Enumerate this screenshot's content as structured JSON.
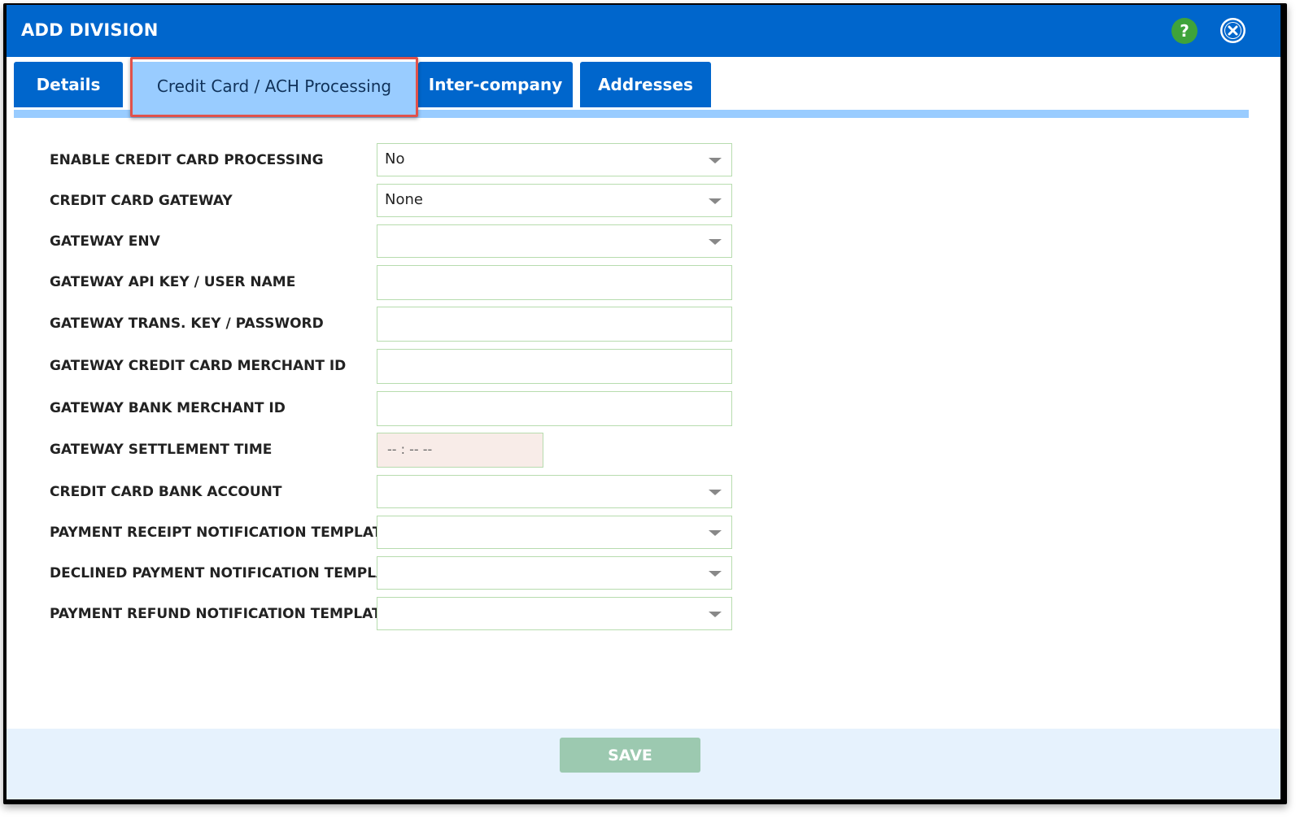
{
  "dialog": {
    "title": "ADD DIVISION",
    "help_icon": "question-mark-icon",
    "help_glyph": "?",
    "close_icon": "close-circle-icon"
  },
  "tabs": [
    {
      "label": "Details",
      "active": false
    },
    {
      "label": "Credit Card / ACH Processing",
      "active": true
    },
    {
      "label": "Inter-company",
      "active": false
    },
    {
      "label": "Addresses",
      "active": false
    }
  ],
  "form": {
    "fields": [
      {
        "label": "ENABLE CREDIT CARD PROCESSING",
        "type": "select",
        "value": "No"
      },
      {
        "label": "CREDIT CARD GATEWAY",
        "type": "select",
        "value": "None"
      },
      {
        "label": "GATEWAY ENV",
        "type": "select",
        "value": ""
      },
      {
        "label": "GATEWAY API KEY / USER NAME",
        "type": "text",
        "value": ""
      },
      {
        "label": "GATEWAY TRANS. KEY / PASSWORD",
        "type": "text",
        "value": ""
      },
      {
        "label": "GATEWAY CREDIT CARD MERCHANT ID",
        "type": "text",
        "value": ""
      },
      {
        "label": "GATEWAY BANK MERCHANT ID",
        "type": "text",
        "value": ""
      },
      {
        "label": "GATEWAY SETTLEMENT TIME",
        "type": "time",
        "value": "-- : --   --"
      },
      {
        "label": "CREDIT CARD BANK ACCOUNT",
        "type": "select",
        "value": ""
      },
      {
        "label": "PAYMENT RECEIPT NOTIFICATION TEMPLATE",
        "type": "select",
        "value": ""
      },
      {
        "label": "DECLINED PAYMENT NOTIFICATION TEMPLATE",
        "type": "select",
        "value": ""
      },
      {
        "label": "PAYMENT REFUND NOTIFICATION TEMPLATE",
        "type": "select",
        "value": ""
      }
    ]
  },
  "footer": {
    "save_label": "SAVE"
  },
  "colors": {
    "header": "#0066cc",
    "tab_active": "#99ccff",
    "highlight": "#e0524b",
    "help": "#3fa33a",
    "save": "#9cc9b0",
    "footer_bg": "#e6f2fd"
  }
}
